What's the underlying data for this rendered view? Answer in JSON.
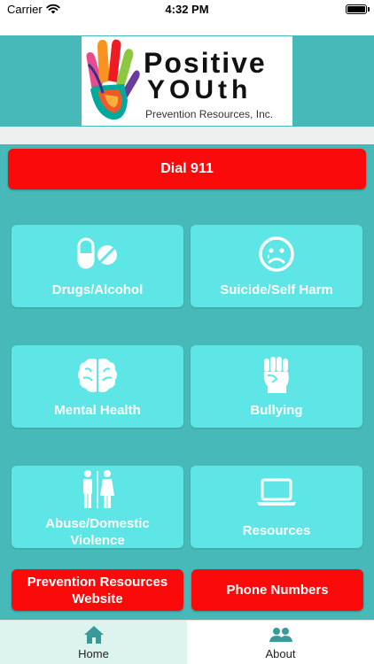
{
  "status_bar": {
    "carrier": "Carrier",
    "time": "4:32 PM"
  },
  "logo": {
    "line1": "Positive",
    "line2": "YOUth",
    "line3": "Prevention Resources, Inc."
  },
  "dial_button": {
    "label": "Dial 911"
  },
  "tiles": [
    {
      "label": "Drugs/Alcohol",
      "icon": "pills-icon"
    },
    {
      "label": "Suicide/Self Harm",
      "icon": "sad-face-icon"
    },
    {
      "label": "Mental Health",
      "icon": "brain-icon"
    },
    {
      "label": "Bullying",
      "icon": "fist-icon"
    },
    {
      "label_line1": "Abuse/Domestic",
      "label_line2": "Violence",
      "icon": "restroom-icon"
    },
    {
      "label": "Resources",
      "icon": "laptop-icon"
    }
  ],
  "bottom_buttons": {
    "website_line1": "Prevention Resources",
    "website_line2": "Website",
    "phone": "Phone Numbers"
  },
  "tab_bar": {
    "home": {
      "label": "Home",
      "icon": "home-icon"
    },
    "about": {
      "label": "About",
      "icon": "users-icon"
    }
  },
  "colors": {
    "teal_background": "#46b9b8",
    "tile": "#5de6e5",
    "alert_red": "#fa0a0a",
    "tab_accent": "#3a9a9a"
  }
}
